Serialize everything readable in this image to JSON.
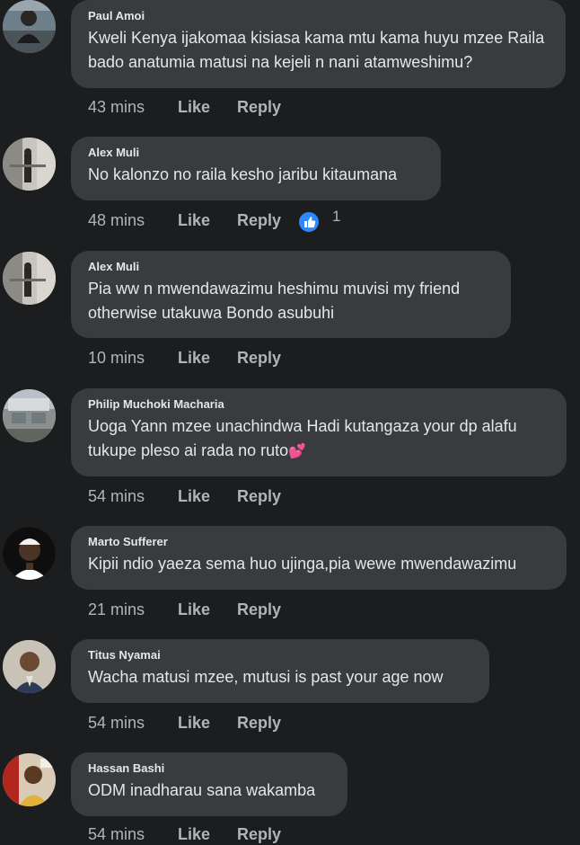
{
  "comments": [
    {
      "author": "Paul Amoi",
      "text": "Kweli Kenya ijakomaa kisiasa kama mtu kama huyu mzee Raila bado anatumia matusi na kejeli n nani atamweshimu?",
      "time": "43 mins",
      "like": "Like",
      "reply": "Reply"
    },
    {
      "author": "Alex Muli",
      "text": "No kalonzo no raila kesho jaribu kitaumana",
      "time": "48 mins",
      "like": "Like",
      "reply": "Reply",
      "reaction_count": "1"
    },
    {
      "author": "Alex Muli",
      "text": "Pia ww n mwendawazimu heshimu muvisi my friend otherwise utakuwa Bondo asubuhi",
      "time": "10 mins",
      "like": "Like",
      "reply": "Reply"
    },
    {
      "author": "Philip Muchoki Macharia",
      "text": "Uoga Yann mzee unachindwa Hadi kutangaza your dp alafu tukupe pleso ai rada no ruto",
      "emoji": "💕",
      "time": "54 mins",
      "like": "Like",
      "reply": "Reply"
    },
    {
      "author": "Marto Sufferer",
      "text": "Kipii ndio yaeza sema huo ujinga,pia wewe mwendawazimu",
      "time": "21 mins",
      "like": "Like",
      "reply": "Reply"
    },
    {
      "author": "Titus Nyamai",
      "text": "Wacha matusi mzee, mutusi is past your age now",
      "time": "54 mins",
      "like": "Like",
      "reply": "Reply"
    },
    {
      "author": "Hassan Bashi",
      "text": "ODM inadharau sana wakamba",
      "time": "54 mins",
      "like": "Like",
      "reply": "Reply"
    }
  ],
  "icons": {
    "reaction": "thumbs-up-reaction-icon",
    "emoji": "two-hearts-emoji"
  },
  "colors": {
    "background": "#1c1d1f",
    "bubble": "#3a3b3c",
    "text": "#e4e6eb",
    "secondary_text": "#b0b3b8",
    "like_reaction": "#2d88ff"
  }
}
